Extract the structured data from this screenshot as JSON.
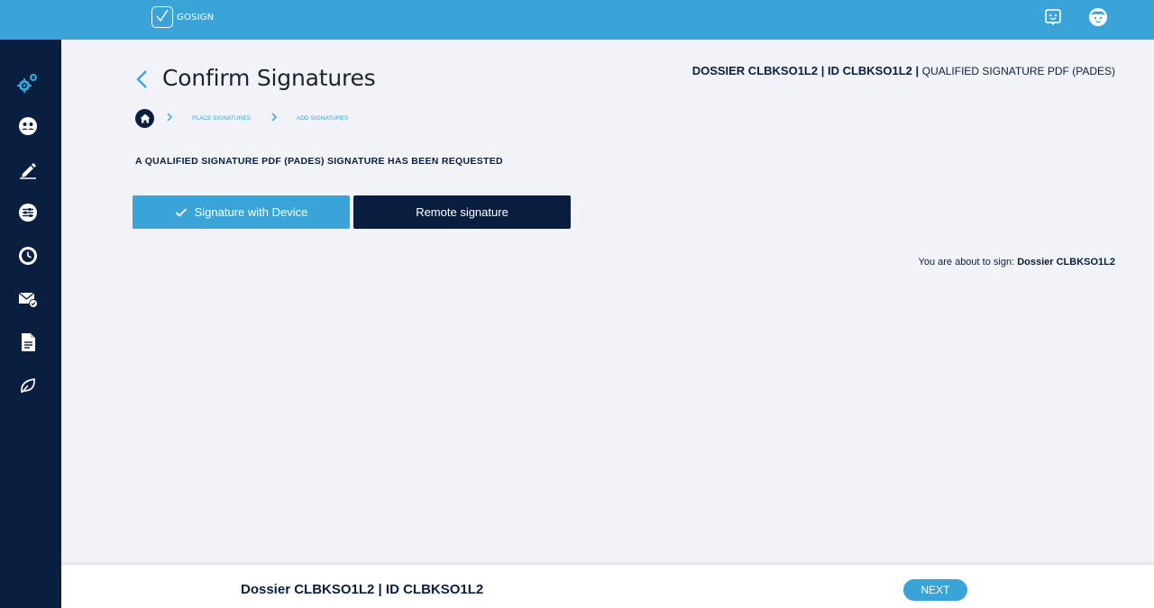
{
  "app": {
    "logo_text": "GOSIGN"
  },
  "topbar": {
    "icons": [
      "chat-bot-icon",
      "user-avatar-icon"
    ]
  },
  "sidebar": {
    "items": [
      {
        "icon": "settings-gear-icon"
      },
      {
        "icon": "faces-icon"
      },
      {
        "icon": "sign-pen-icon"
      },
      {
        "icon": "sliders-icon"
      },
      {
        "icon": "history-clock-icon"
      },
      {
        "icon": "mail-check-icon"
      },
      {
        "icon": "document-icon"
      },
      {
        "icon": "leaf-icon"
      }
    ]
  },
  "page": {
    "title": "Confirm Signatures",
    "dossier_bold": "DOSSIER CLBKSO1L2 | ID CLBKSO1L2 |",
    "dossier_type": "QUALIFIED SIGNATURE PDF (PADES)"
  },
  "breadcrumb": {
    "items": [
      {
        "label": "PLACE SIGNATURES"
      },
      {
        "label": "ADD SIGNATURES"
      }
    ]
  },
  "request_text": "A QUALIFIED SIGNATURE PDF (PADES) SIGNATURE HAS BEEN REQUESTED",
  "buttons": {
    "device_label": "Signature with Device",
    "remote_label": "Remote signature"
  },
  "about_sign": {
    "prefix": "You are about to sign:",
    "name": "Dossier CLBKSO1L2"
  },
  "footer": {
    "dossier": "Dossier CLBKSO1L2 | ID CLBKSO1L2",
    "next_label": "NEXT"
  },
  "colors": {
    "primary": "#3aa3d8",
    "navy": "#0a1e3f",
    "background": "#f1f3f8"
  }
}
